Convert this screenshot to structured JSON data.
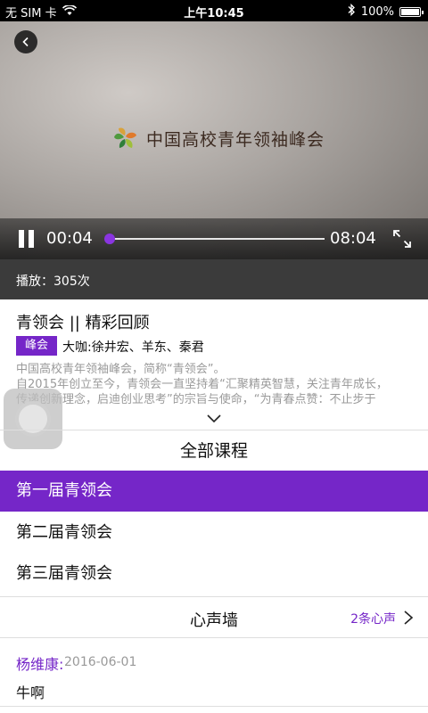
{
  "status_bar": {
    "carrier": "无 SIM 卡",
    "time": "上午10:45",
    "battery_percent": "100%"
  },
  "video": {
    "overlay_title": "中国高校青年领袖峰会",
    "current_time": "00:04",
    "total_time": "08:04",
    "progress": 0.01
  },
  "play_count": "播放：305次",
  "info": {
    "title": "青领会 || 精彩回顾",
    "tag": "峰会",
    "guests": "大咖:徐井宏、羊东、秦君",
    "description_lines": [
      "中国高校青年领袖峰会，简称“青领会”。",
      "自2015年创立至今，青领会一直坚持着“汇聚精英智慧，关注青年成长，",
      "传递创新理念，启迪创业思考”的宗旨与使命，“为青春点赞：不止步于"
    ]
  },
  "courses": {
    "header": "全部课程",
    "items": [
      {
        "label": "第一届青领会",
        "active": true
      },
      {
        "label": "第二届青领会",
        "active": false
      },
      {
        "label": "第三届青领会",
        "active": false
      }
    ]
  },
  "voice_wall": {
    "title": "心声墙",
    "count_label": "2条心声",
    "comments": [
      {
        "author": "杨维康:",
        "date": "2016-06-01",
        "text": "牛啊"
      }
    ]
  },
  "colors": {
    "accent": "#7526c8",
    "dark_bar": "#3b3b3b"
  }
}
